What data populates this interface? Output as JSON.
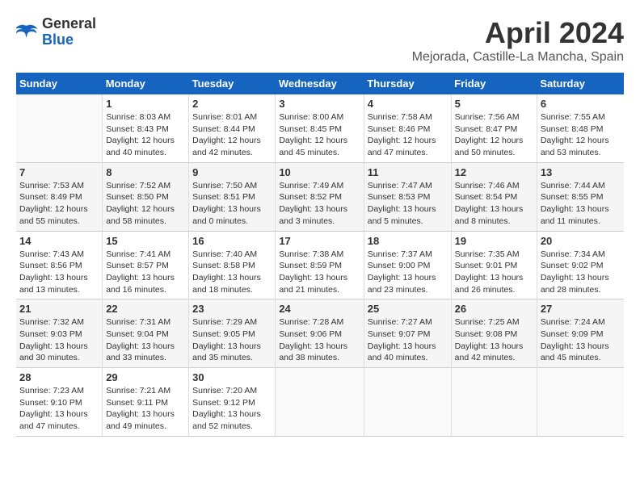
{
  "header": {
    "logo_general": "General",
    "logo_blue": "Blue",
    "month_title": "April 2024",
    "location": "Mejorada, Castille-La Mancha, Spain"
  },
  "calendar": {
    "days_of_week": [
      "Sunday",
      "Monday",
      "Tuesday",
      "Wednesday",
      "Thursday",
      "Friday",
      "Saturday"
    ],
    "weeks": [
      [
        {
          "day": "",
          "info": ""
        },
        {
          "day": "1",
          "info": "Sunrise: 8:03 AM\nSunset: 8:43 PM\nDaylight: 12 hours\nand 40 minutes."
        },
        {
          "day": "2",
          "info": "Sunrise: 8:01 AM\nSunset: 8:44 PM\nDaylight: 12 hours\nand 42 minutes."
        },
        {
          "day": "3",
          "info": "Sunrise: 8:00 AM\nSunset: 8:45 PM\nDaylight: 12 hours\nand 45 minutes."
        },
        {
          "day": "4",
          "info": "Sunrise: 7:58 AM\nSunset: 8:46 PM\nDaylight: 12 hours\nand 47 minutes."
        },
        {
          "day": "5",
          "info": "Sunrise: 7:56 AM\nSunset: 8:47 PM\nDaylight: 12 hours\nand 50 minutes."
        },
        {
          "day": "6",
          "info": "Sunrise: 7:55 AM\nSunset: 8:48 PM\nDaylight: 12 hours\nand 53 minutes."
        }
      ],
      [
        {
          "day": "7",
          "info": "Sunrise: 7:53 AM\nSunset: 8:49 PM\nDaylight: 12 hours\nand 55 minutes."
        },
        {
          "day": "8",
          "info": "Sunrise: 7:52 AM\nSunset: 8:50 PM\nDaylight: 12 hours\nand 58 minutes."
        },
        {
          "day": "9",
          "info": "Sunrise: 7:50 AM\nSunset: 8:51 PM\nDaylight: 13 hours\nand 0 minutes."
        },
        {
          "day": "10",
          "info": "Sunrise: 7:49 AM\nSunset: 8:52 PM\nDaylight: 13 hours\nand 3 minutes."
        },
        {
          "day": "11",
          "info": "Sunrise: 7:47 AM\nSunset: 8:53 PM\nDaylight: 13 hours\nand 5 minutes."
        },
        {
          "day": "12",
          "info": "Sunrise: 7:46 AM\nSunset: 8:54 PM\nDaylight: 13 hours\nand 8 minutes."
        },
        {
          "day": "13",
          "info": "Sunrise: 7:44 AM\nSunset: 8:55 PM\nDaylight: 13 hours\nand 11 minutes."
        }
      ],
      [
        {
          "day": "14",
          "info": "Sunrise: 7:43 AM\nSunset: 8:56 PM\nDaylight: 13 hours\nand 13 minutes."
        },
        {
          "day": "15",
          "info": "Sunrise: 7:41 AM\nSunset: 8:57 PM\nDaylight: 13 hours\nand 16 minutes."
        },
        {
          "day": "16",
          "info": "Sunrise: 7:40 AM\nSunset: 8:58 PM\nDaylight: 13 hours\nand 18 minutes."
        },
        {
          "day": "17",
          "info": "Sunrise: 7:38 AM\nSunset: 8:59 PM\nDaylight: 13 hours\nand 21 minutes."
        },
        {
          "day": "18",
          "info": "Sunrise: 7:37 AM\nSunset: 9:00 PM\nDaylight: 13 hours\nand 23 minutes."
        },
        {
          "day": "19",
          "info": "Sunrise: 7:35 AM\nSunset: 9:01 PM\nDaylight: 13 hours\nand 26 minutes."
        },
        {
          "day": "20",
          "info": "Sunrise: 7:34 AM\nSunset: 9:02 PM\nDaylight: 13 hours\nand 28 minutes."
        }
      ],
      [
        {
          "day": "21",
          "info": "Sunrise: 7:32 AM\nSunset: 9:03 PM\nDaylight: 13 hours\nand 30 minutes."
        },
        {
          "day": "22",
          "info": "Sunrise: 7:31 AM\nSunset: 9:04 PM\nDaylight: 13 hours\nand 33 minutes."
        },
        {
          "day": "23",
          "info": "Sunrise: 7:29 AM\nSunset: 9:05 PM\nDaylight: 13 hours\nand 35 minutes."
        },
        {
          "day": "24",
          "info": "Sunrise: 7:28 AM\nSunset: 9:06 PM\nDaylight: 13 hours\nand 38 minutes."
        },
        {
          "day": "25",
          "info": "Sunrise: 7:27 AM\nSunset: 9:07 PM\nDaylight: 13 hours\nand 40 minutes."
        },
        {
          "day": "26",
          "info": "Sunrise: 7:25 AM\nSunset: 9:08 PM\nDaylight: 13 hours\nand 42 minutes."
        },
        {
          "day": "27",
          "info": "Sunrise: 7:24 AM\nSunset: 9:09 PM\nDaylight: 13 hours\nand 45 minutes."
        }
      ],
      [
        {
          "day": "28",
          "info": "Sunrise: 7:23 AM\nSunset: 9:10 PM\nDaylight: 13 hours\nand 47 minutes."
        },
        {
          "day": "29",
          "info": "Sunrise: 7:21 AM\nSunset: 9:11 PM\nDaylight: 13 hours\nand 49 minutes."
        },
        {
          "day": "30",
          "info": "Sunrise: 7:20 AM\nSunset: 9:12 PM\nDaylight: 13 hours\nand 52 minutes."
        },
        {
          "day": "",
          "info": ""
        },
        {
          "day": "",
          "info": ""
        },
        {
          "day": "",
          "info": ""
        },
        {
          "day": "",
          "info": ""
        }
      ]
    ]
  }
}
